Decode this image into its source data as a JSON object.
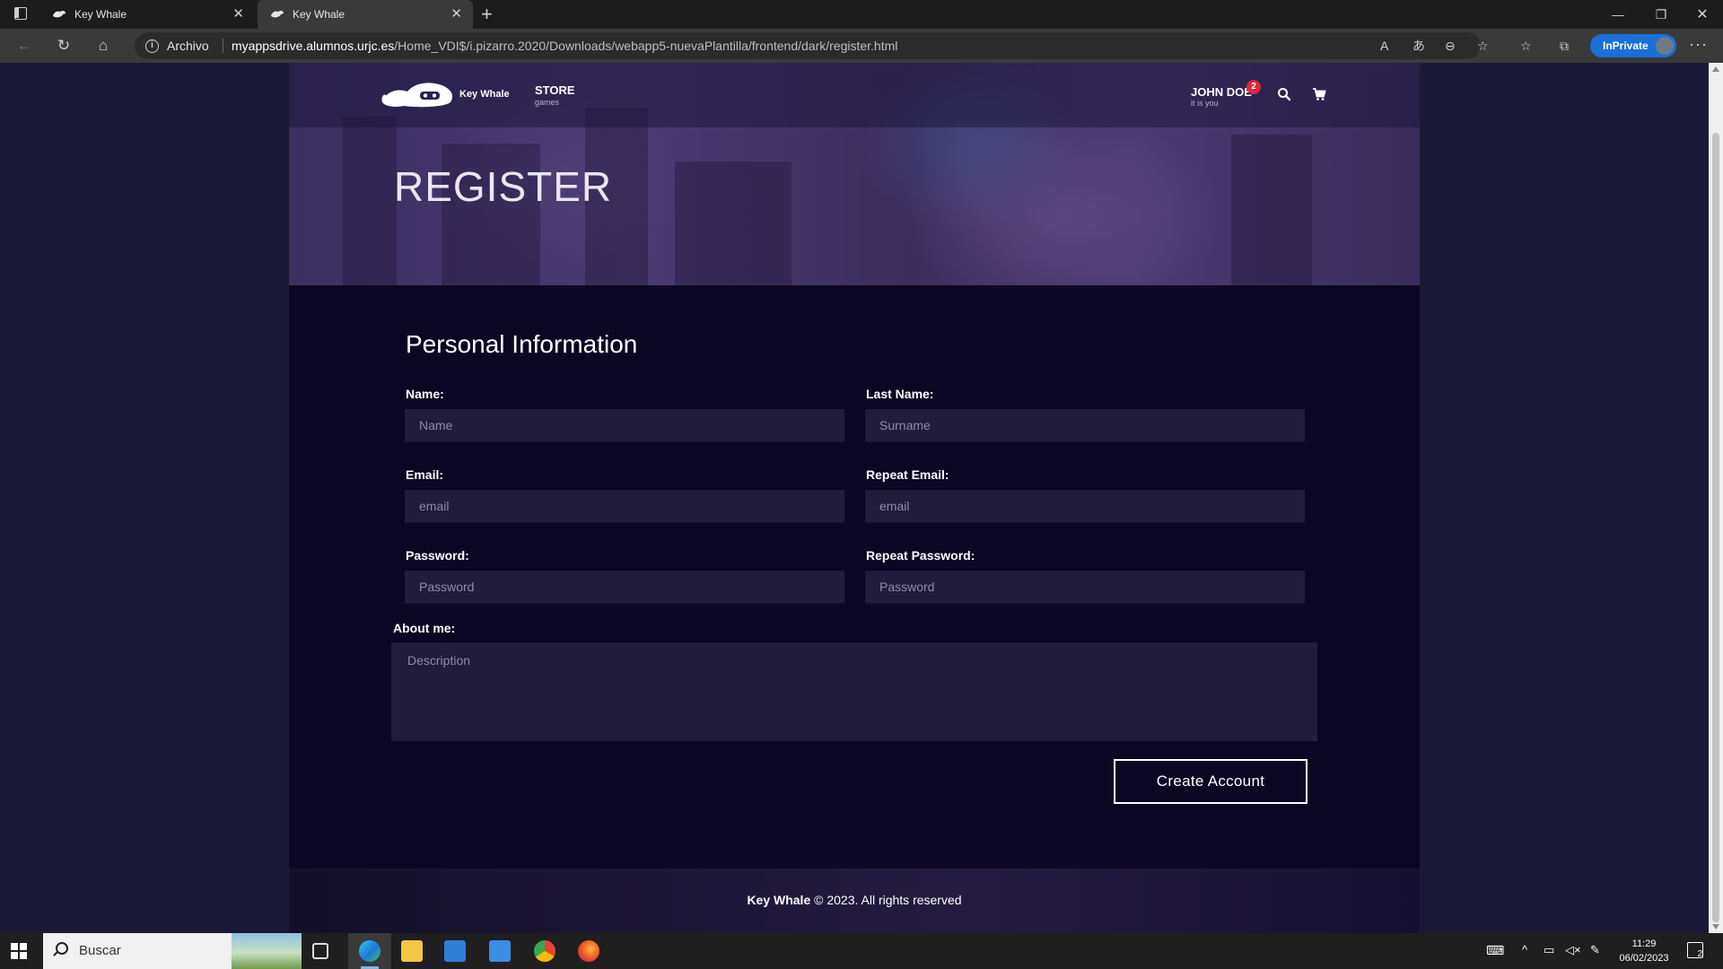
{
  "browser": {
    "tabs": [
      {
        "title": "Key Whale"
      },
      {
        "title": "Key Whale"
      }
    ],
    "address": {
      "site_info": "Archivo",
      "host": "myappsdrive.alumnos.urjc.es",
      "path": "/Home_VDI$/i.pizarro.2020/Downloads/webapp5-nuevaPlantilla/frontend/dark/register.html"
    },
    "inprivate_label": "InPrivate"
  },
  "site": {
    "brand": "Key Whale",
    "nav_store": "STORE",
    "nav_store_sub": "games",
    "user_name": "JOHN DOE",
    "user_sub": "it is you",
    "cart_badge": "2"
  },
  "hero": {
    "title": "REGISTER"
  },
  "form": {
    "section_title": "Personal Information",
    "name_label": "Name:",
    "name_placeholder": "Name",
    "lastname_label": "Last Name:",
    "lastname_placeholder": "Surname",
    "email_label": "Email:",
    "email_placeholder": "email",
    "repeat_email_label": "Repeat Email:",
    "repeat_email_placeholder": "email",
    "password_label": "Password:",
    "password_placeholder": "Password",
    "repeat_password_label": "Repeat Password:",
    "repeat_password_placeholder": "Password",
    "about_label": "About me:",
    "about_placeholder": "Description",
    "submit_label": "Create Account"
  },
  "footer": {
    "brand": "Key Whale",
    "rest": " © 2023. All rights reserved"
  },
  "taskbar": {
    "search_placeholder": "Buscar",
    "time": "11:29",
    "date": "06/02/2023",
    "notification_count": "2"
  },
  "colors": {
    "page_bg": "#1b1a36",
    "content_bg": "#0b0722",
    "input_bg": "#211c3a",
    "badge": "#e2263d",
    "inprivate": "#1b6fd8"
  }
}
